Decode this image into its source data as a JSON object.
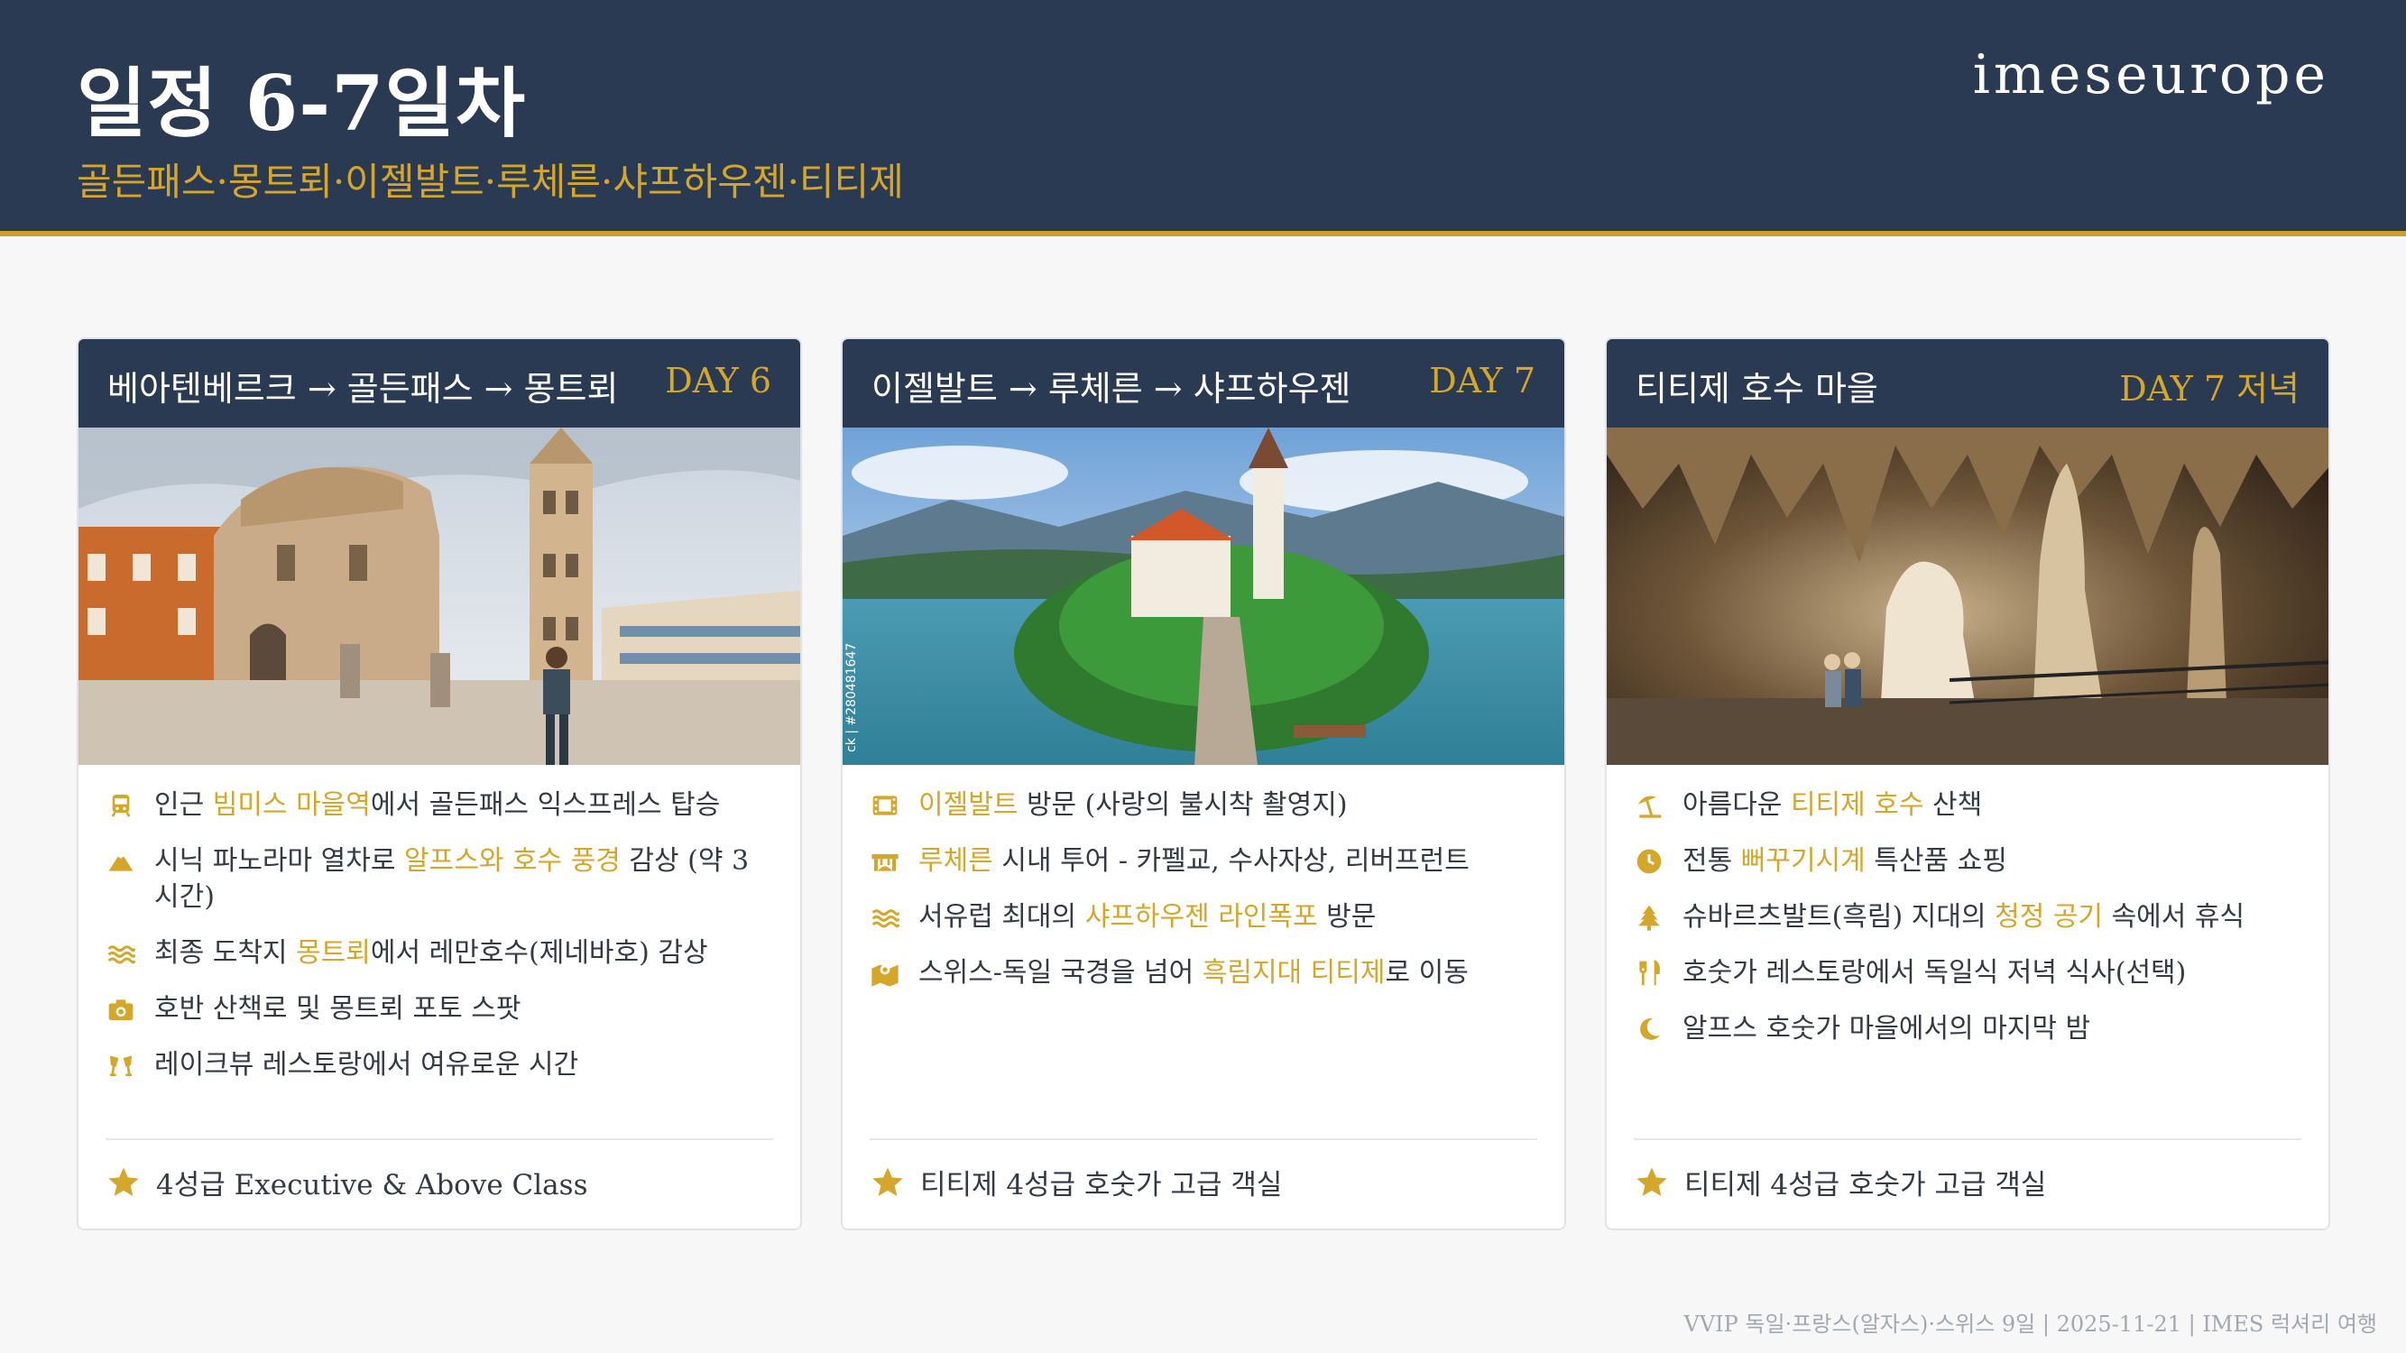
{
  "header": {
    "title": "일정 6-7일차",
    "subtitle": "골든패스·몽트뢰·이젤발트·루체른·샤프하우젠·티티제",
    "brand": "imeseurope"
  },
  "colors": {
    "navy": "#2a3a52",
    "gold": "#d4a62a",
    "text": "#333a44"
  },
  "cards": [
    {
      "title": "베아텐베르크 → 골든패스 → 몽트뢰",
      "day": "DAY 6",
      "image": "rotunda-church-bell-tower-photo",
      "items": [
        {
          "icon": "train-icon",
          "pre": "인근 ",
          "hl": "빔미스 마을역",
          "post": "에서 골든패스 익스프레스 탑승"
        },
        {
          "icon": "mountain-icon",
          "pre": "시닉 파노라마 열차로 ",
          "hl": "알프스와 호수 풍경",
          "post": " 감상 (약 3시간)"
        },
        {
          "icon": "water-icon",
          "pre": "최종 도착지 ",
          "hl": "몽트뢰",
          "post": "에서 레만호수(제네바호) 감상"
        },
        {
          "icon": "camera-icon",
          "pre": "호반 산책로 및 몽트뢰 포토 스팟",
          "hl": "",
          "post": ""
        },
        {
          "icon": "glasses-cheers-icon",
          "pre": "레이크뷰 레스토랑에서 여유로운 시간",
          "hl": "",
          "post": ""
        }
      ],
      "footer": "4성급 Executive & Above Class"
    },
    {
      "title": "이젤발트 → 루체른 → 샤프하우젠",
      "day": "DAY 7",
      "image": "lake-island-church-photo",
      "image_caption": "ck | #280481647",
      "items": [
        {
          "icon": "film-icon",
          "pre": "",
          "hl": "이젤발트",
          "post": " 방문 (사랑의 불시착 촬영지)"
        },
        {
          "icon": "bridge-icon",
          "pre": "",
          "hl": "루체른",
          "post": " 시내 투어 - 카펠교, 수사자상, 리버프런트"
        },
        {
          "icon": "water-icon",
          "pre": "서유럽 최대의 ",
          "hl": "샤프하우젠 라인폭포",
          "post": " 방문"
        },
        {
          "icon": "map-marked-icon",
          "pre": "스위스-독일 국경을 넘어 ",
          "hl": "흑림지대 티티제",
          "post": "로 이동"
        }
      ],
      "footer": "티티제 4성급 호숫가 고급 객실"
    },
    {
      "title": "티티제 호수 마을",
      "day": "DAY 7 저녁",
      "image": "cave-stalactites-photo",
      "items": [
        {
          "icon": "umbrella-beach-icon",
          "pre": "아름다운 ",
          "hl": "티티제 호수",
          "post": " 산책"
        },
        {
          "icon": "clock-icon",
          "pre": "전통 ",
          "hl": "뻐꾸기시계",
          "post": " 특산품 쇼핑"
        },
        {
          "icon": "tree-icon",
          "pre": "슈바르츠발트(흑림) 지대의 ",
          "hl": "청정 공기",
          "post": " 속에서 휴식"
        },
        {
          "icon": "utensils-icon",
          "pre": "호숫가 레스토랑에서 독일식 저녁 식사(선택)",
          "hl": "",
          "post": ""
        },
        {
          "icon": "moon-icon",
          "pre": "알프스 호숫가 마을에서의 마지막 밤",
          "hl": "",
          "post": ""
        }
      ],
      "footer": "티티제 4성급 호숫가 고급 객실"
    }
  ],
  "footer_note": "VVIP 독일·프랑스(알자스)·스위스 9일 | 2025-11-21 | IMES 럭셔리 여행"
}
